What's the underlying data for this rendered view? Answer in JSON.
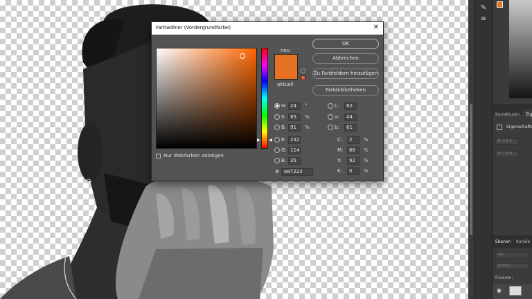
{
  "dialog": {
    "title": "Farbwähler (Vordergrundfarbe)",
    "close_glyph": "✕",
    "label_new": "neu",
    "label_current": "aktuell",
    "new_color": "#e87223",
    "current_color": "#e87223",
    "gamut_color": "#e8603a",
    "buttons": {
      "ok": "OK",
      "cancel": "Abbrechen",
      "add_to_swatches": "Zu Farbfeldern hinzufügen",
      "color_libraries": "Farbbibliotheken"
    },
    "web_colors_label": "Nur Webfarben anzeigen",
    "hsb": [
      {
        "label": "H:",
        "value": "24",
        "unit": "°",
        "checked": true
      },
      {
        "label": "S:",
        "value": "85",
        "unit": "%",
        "checked": false
      },
      {
        "label": "B:",
        "value": "91",
        "unit": "%",
        "checked": false
      }
    ],
    "rgb": [
      {
        "label": "R:",
        "value": "232",
        "checked": false
      },
      {
        "label": "G:",
        "value": "114",
        "checked": false
      },
      {
        "label": "B:",
        "value": "35",
        "checked": false
      }
    ],
    "lab": [
      {
        "label": "L:",
        "value": "62"
      },
      {
        "label": "a:",
        "value": "44"
      },
      {
        "label": "b:",
        "value": "61"
      }
    ],
    "cmyk": [
      {
        "label": "C:",
        "value": "2",
        "unit": "%"
      },
      {
        "label": "M:",
        "value": "66",
        "unit": "%"
      },
      {
        "label": "Y:",
        "value": "92",
        "unit": "%"
      },
      {
        "label": "K:",
        "value": "0",
        "unit": "%"
      }
    ],
    "hex_symbol": "#",
    "hex": "e87223"
  },
  "panels": {
    "tab_corrections": "Korrekturen",
    "tab_properties": "Eige",
    "properties_title": "Eigenschaften",
    "field_b": "B: 7,5 ft",
    "field_h": "H: 7,9 ft",
    "tab_layers": "Ebenen",
    "tab_channels": "Kanäle",
    "search_placeholder": "Art",
    "blend_mode": "Normal",
    "lock_label": "Fixieren:"
  },
  "colors": {
    "accent_orange": "#e87223"
  }
}
